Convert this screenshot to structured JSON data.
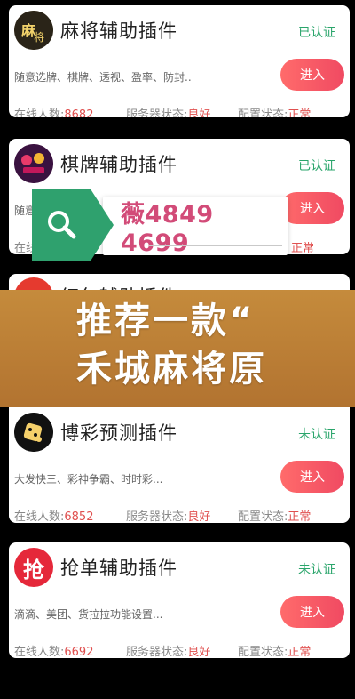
{
  "cards": [
    {
      "title": "麻将辅助插件",
      "status": "已认证",
      "desc": "随意选牌、棋牌、透视、盈率、防封..",
      "enter": "进入",
      "online_label": "在线人数:",
      "online": "8682",
      "server_label": "服务器状态:",
      "server": "良好",
      "config_label": "配置状态:",
      "config": "正常"
    },
    {
      "title": "棋牌辅助插件",
      "status": "已认证",
      "desc": "随意",
      "enter": "进入",
      "online_label": "在线",
      "config": "正常"
    },
    {
      "title": "红包辅助插件"
    },
    {
      "title": "博彩预测插件",
      "status": "未认证",
      "desc": "大发快三、彩神争霸、时时彩...",
      "enter": "进入",
      "online_label": "在线人数:",
      "online": "6852",
      "server_label": "服务器状态:",
      "server": "良好",
      "config_label": "配置状态:",
      "config": "正常"
    },
    {
      "title": "抢单辅助插件",
      "status": "未认证",
      "desc": "滴滴、美团、货拉拉功能设置...",
      "enter": "进入",
      "online_label": "在线人数:",
      "online": "6692",
      "server_label": "服务器状态:",
      "server": "良好",
      "config_label": "配置状态:",
      "config": "正常"
    }
  ],
  "overlay": {
    "search_text": "薇4849 4699",
    "search_icon": "search-icon"
  },
  "banner": {
    "line1": "推荐一款“",
    "line2": "禾城麻将原"
  },
  "logos": {
    "card3_char": "抢"
  }
}
